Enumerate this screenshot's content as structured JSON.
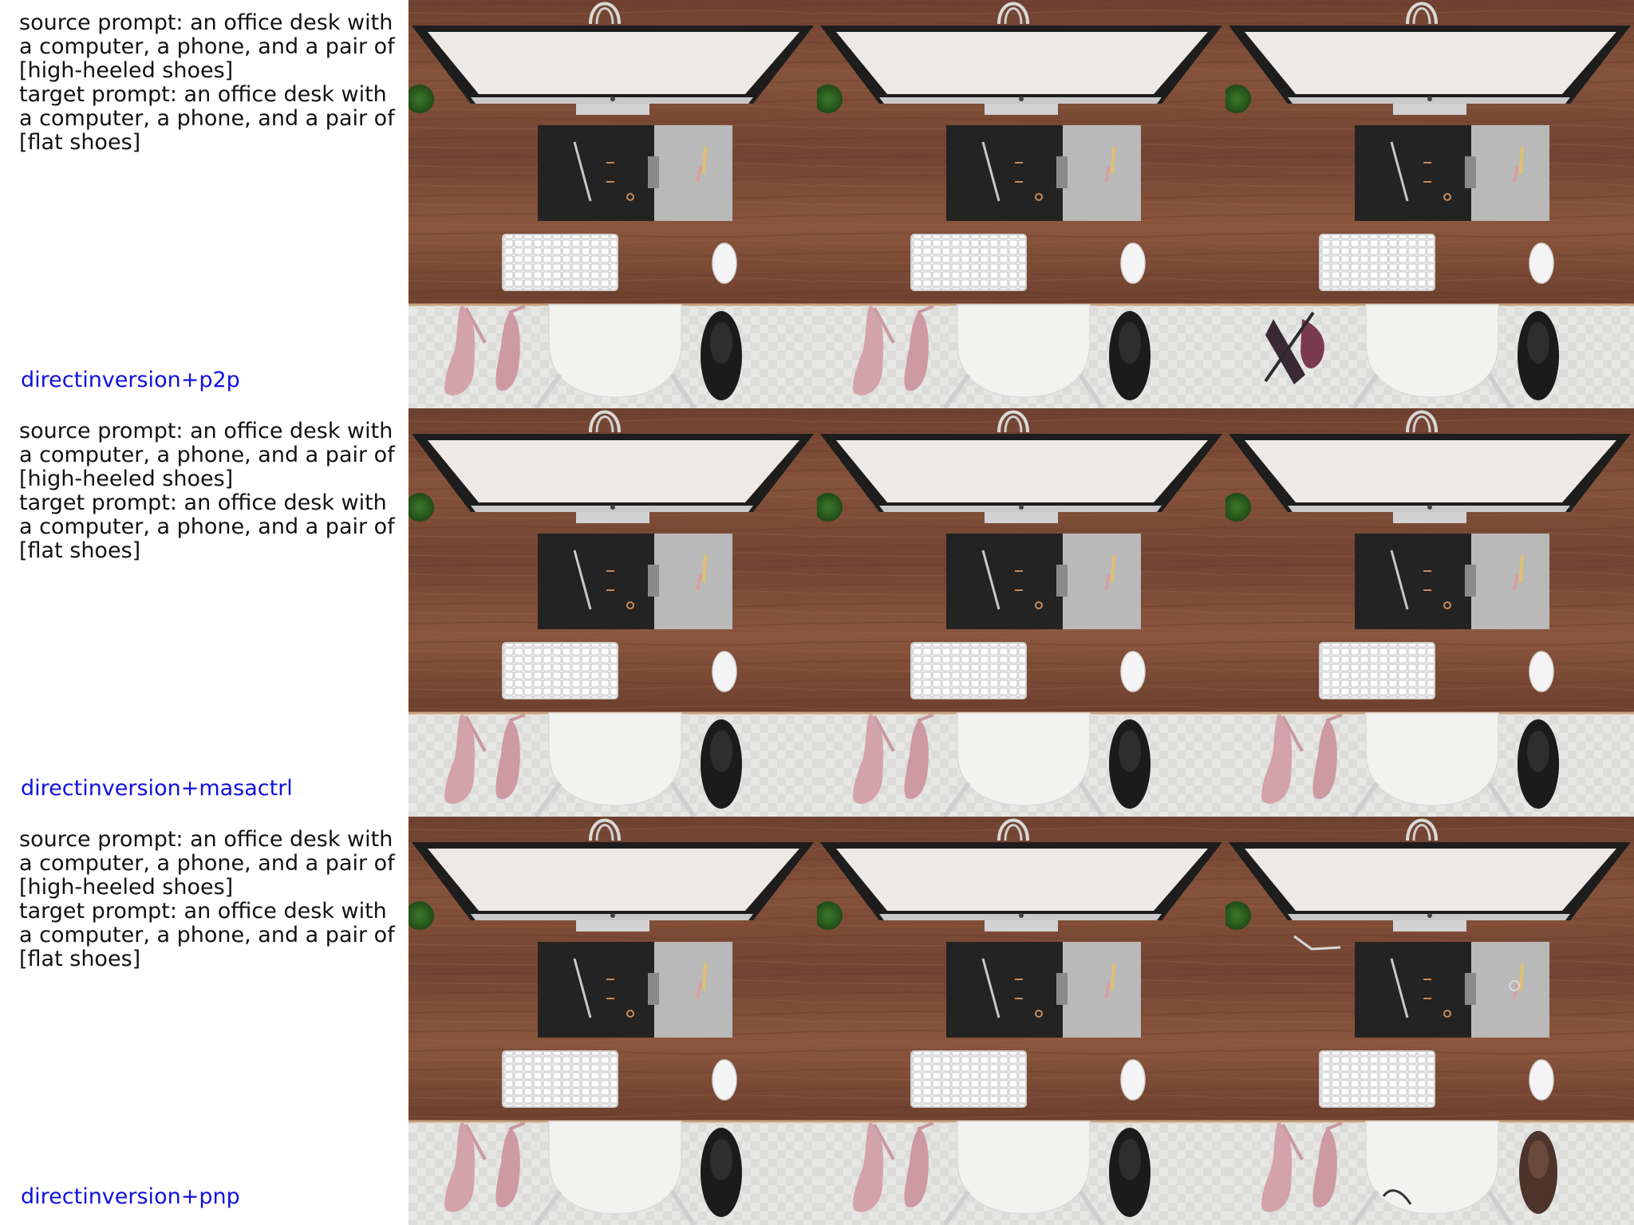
{
  "rows": [
    {
      "source_prompt": "source prompt: an office desk with a computer, a phone, and a pair of [high-heeled shoes]",
      "target_prompt": "target prompt: an office desk with a computer, a phone, and a pair of [flat shoes]",
      "method": "directinversion+p2p"
    },
    {
      "source_prompt": "source prompt: an office desk with a computer, a phone, and a pair of [high-heeled shoes]",
      "target_prompt": "target prompt: an office desk with a computer, a phone, and a pair of [flat shoes]",
      "method": "directinversion+masactrl"
    },
    {
      "source_prompt": "source prompt: an office desk with a computer, a phone, and a pair of [high-heeled shoes]",
      "target_prompt": "target prompt: an office desk with a computer, a phone, and a pair of [flat shoes]",
      "method": "directinversion+pnp"
    }
  ],
  "colors": {
    "method_label": "#1010e0",
    "desk_wood": "#7a4a35",
    "floor": "#e6e6e4"
  }
}
